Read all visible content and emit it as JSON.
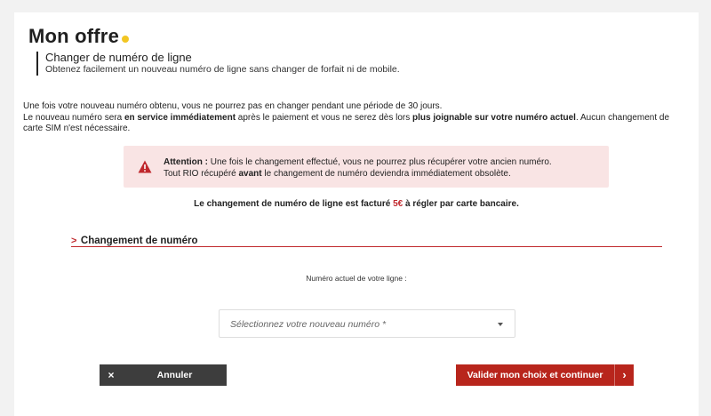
{
  "colors": {
    "accent_red": "#c0282d",
    "title_dot_yellow": "#f2c623",
    "alert_bg": "#f9e4e4",
    "cancel_bg": "#3d3d3d",
    "validate_bg": "#b8251c"
  },
  "header": {
    "title": "Mon offre"
  },
  "subheader": {
    "title": "Changer de numéro de ligne",
    "description": "Obtenez facilement un nouveau numéro de ligne sans changer de forfait ni de mobile."
  },
  "info": {
    "line1": "Une fois votre nouveau numéro obtenu, vous ne pourrez pas en changer pendant une période de 30 jours.",
    "line2_a": "Le nouveau numéro sera ",
    "line2_bold1": "en service immédiatement",
    "line2_b": " après le paiement et vous ne serez dès lors ",
    "line2_bold2": "plus joignable sur votre numéro actuel",
    "line2_c": ". Aucun changement de carte SIM n'est nécessaire."
  },
  "alert": {
    "icon": "warning-triangle-icon",
    "label": "Attention :",
    "line1": " Une fois le changement effectué, vous ne pourrez plus récupérer votre ancien numéro.",
    "line2_a": "Tout RIO récupéré ",
    "line2_bold": "avant",
    "line2_b": " le changement de numéro deviendra immédiatement obsolète."
  },
  "fee": {
    "text_a": "Le changement de numéro de ligne est facturé ",
    "price": "5€",
    "text_b": " à régler par carte bancaire."
  },
  "section": {
    "arrow": ">",
    "title": "Changement de numéro"
  },
  "current_number": {
    "label": "Numéro actuel de votre ligne :"
  },
  "select": {
    "placeholder": "Sélectionnez votre nouveau numéro *",
    "icon": "caret-down-icon"
  },
  "buttons": {
    "cancel_icon": "×",
    "cancel_label": "Annuler",
    "validate_label": "Valider mon choix et continuer",
    "validate_icon": "›"
  }
}
